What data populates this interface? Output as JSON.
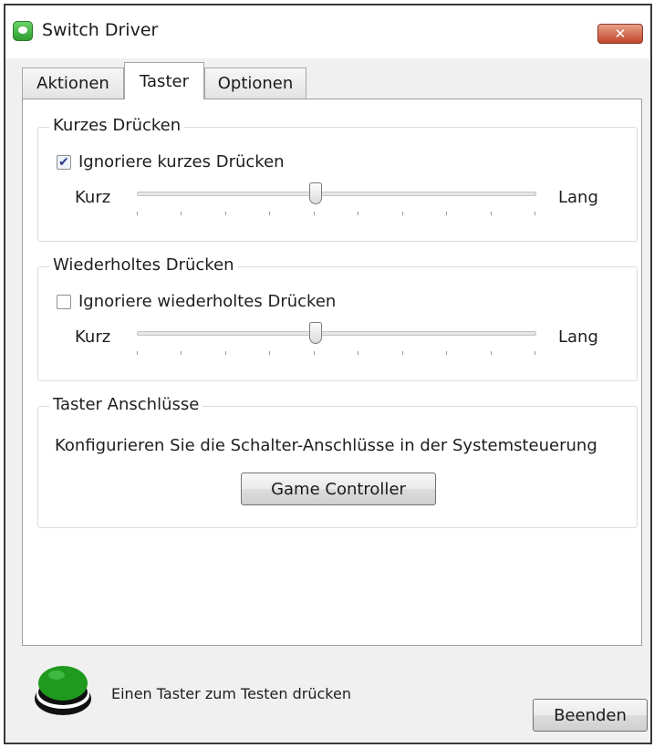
{
  "window": {
    "title": "Switch Driver",
    "close_label": "✕"
  },
  "tabs": [
    {
      "label": "Aktionen",
      "active": false
    },
    {
      "label": "Taster",
      "active": true
    },
    {
      "label": "Optionen",
      "active": false
    }
  ],
  "short_press": {
    "group_title": "Kurzes Drücken",
    "checkbox_label": "Ignoriere kurzes Drücken",
    "checked": true,
    "slider_min_label": "Kurz",
    "slider_max_label": "Lang",
    "slider_value_fraction": 0.45
  },
  "repeated_press": {
    "group_title": "Wiederholtes Drücken",
    "checkbox_label": "Ignoriere wiederholtes Drücken",
    "checked": false,
    "slider_min_label": "Kurz",
    "slider_max_label": "Lang",
    "slider_value_fraction": 0.45
  },
  "ports": {
    "group_title": "Taster Anschlüsse",
    "info_text": "Konfigurieren Sie die Schalter-Anschlüsse in der Systemsteuerung",
    "button_label": "Game Controller"
  },
  "footer": {
    "status_text": "Einen Taster zum Testen drücken",
    "exit_label": "Beenden",
    "indicator_color": "#1f9a1f"
  },
  "check_mark": "✔"
}
